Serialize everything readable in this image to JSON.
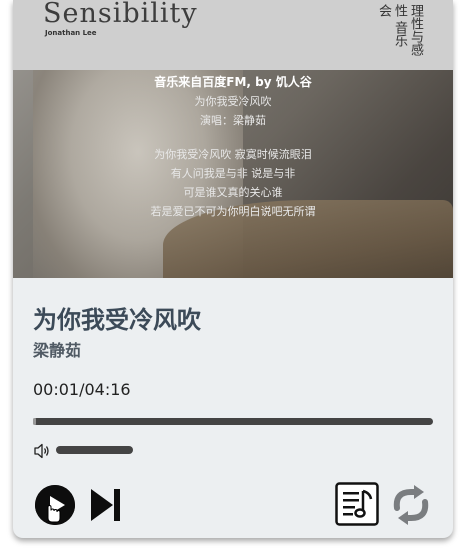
{
  "cover": {
    "album_title": "Sensibility",
    "album_artist": "Jonathan Lee",
    "album_cn": "理性与感性 音乐会"
  },
  "lyrics": {
    "source": "音乐来自百度FM, by 饥人谷",
    "title_line": "为你我受冷风吹",
    "singer_line": "演唱：梁静茹",
    "lines": [
      "为你我受冷风吹 寂寞时候流眼泪",
      "有人问我是与非 说是与非",
      "可是谁又真的关心谁",
      "若是爱已不可为你明白说吧无所谓"
    ]
  },
  "song": {
    "title": "为你我受冷风吹",
    "artist": "梁静茹"
  },
  "playback": {
    "time": "00:01/04:16",
    "progress_fraction": 0.004,
    "volume_fraction": 1.0
  },
  "icons": {
    "volume": "volume-icon",
    "play": "play-icon",
    "next": "skip-next-icon",
    "playlist": "playlist-music-icon",
    "repeat": "repeat-icon"
  },
  "colors": {
    "card_bg": "#eceff1",
    "title": "#3c4a58",
    "control": "#0d0d0d",
    "repeat": "#7a7d80"
  }
}
